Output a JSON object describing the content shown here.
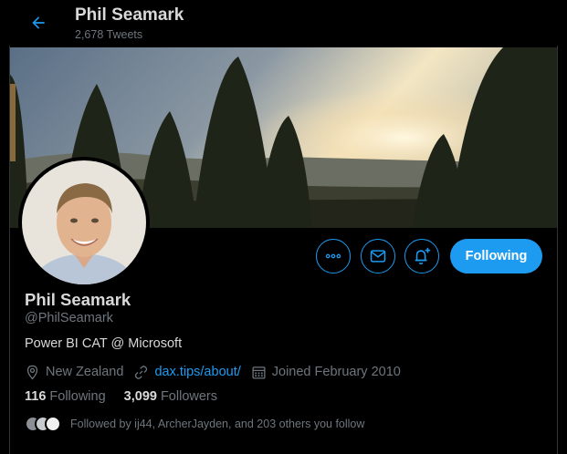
{
  "header": {
    "name": "Phil Seamark",
    "tweet_count": "2,678 Tweets",
    "back_icon": "arrow-left-icon"
  },
  "profile": {
    "display_name": "Phil Seamark",
    "handle": "@PhilSeamark",
    "bio": "Power BI CAT @ Microsoft",
    "location": "New Zealand",
    "website": "dax.tips/about/",
    "joined": "Joined February 2010"
  },
  "actions": {
    "more_icon": "more-icon",
    "message_icon": "mail-icon",
    "notify_icon": "bell-plus-icon",
    "following_label": "Following"
  },
  "stats": {
    "following_count": "116",
    "following_label": "Following",
    "followers_count": "3,099",
    "followers_label": "Followers"
  },
  "followed_by": {
    "text": "Followed by ij44, ArcherJayden, and 203 others you follow"
  },
  "colors": {
    "accent": "#1d9bf0",
    "background": "#000000",
    "text_primary": "#d9d9d9",
    "text_secondary": "#6e767d"
  }
}
